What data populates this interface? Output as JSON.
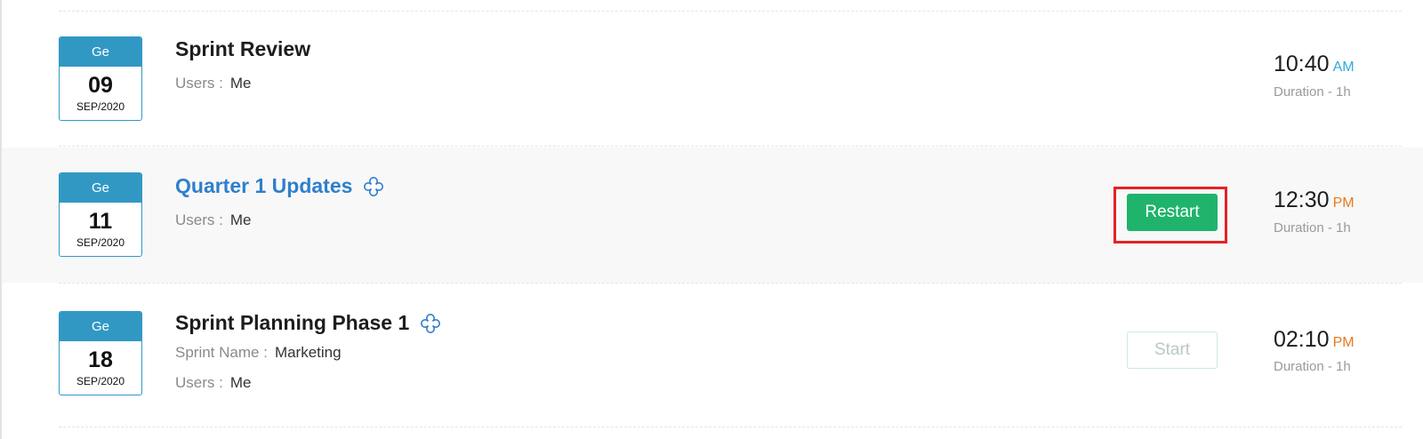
{
  "meetings": [
    {
      "calendar": {
        "weekday": "Ge",
        "day": "09",
        "month_year": "SEP/2020"
      },
      "title": "Sprint Review",
      "recurring": false,
      "users_label": "Users :",
      "users_value": "Me",
      "time": "10:40",
      "ampm": "AM",
      "duration": "Duration - 1h"
    },
    {
      "calendar": {
        "weekday": "Ge",
        "day": "11",
        "month_year": "SEP/2020"
      },
      "title": "Quarter 1 Updates",
      "recurring": true,
      "recurring_icon": "recurring-icon",
      "users_label": "Users :",
      "users_value": "Me",
      "action_label": "Restart",
      "time": "12:30",
      "ampm": "PM",
      "duration": "Duration - 1h"
    },
    {
      "calendar": {
        "weekday": "Ge",
        "day": "18",
        "month_year": "SEP/2020"
      },
      "title": "Sprint Planning Phase 1",
      "recurring": true,
      "recurring_icon": "recurring-icon",
      "sprint_label": "Sprint Name :",
      "sprint_value": "Marketing",
      "users_label": "Users :",
      "users_value": "Me",
      "action_label": "Start",
      "time": "02:10",
      "ampm": "PM",
      "duration": "Duration - 1h"
    }
  ],
  "colors": {
    "calendar_accent": "#3198c4",
    "link_title": "#2f7fcc",
    "restart_button": "#1fb36b",
    "am_color": "#33aadd",
    "pm_color": "#e67a22",
    "highlight_box": "#e52222"
  }
}
